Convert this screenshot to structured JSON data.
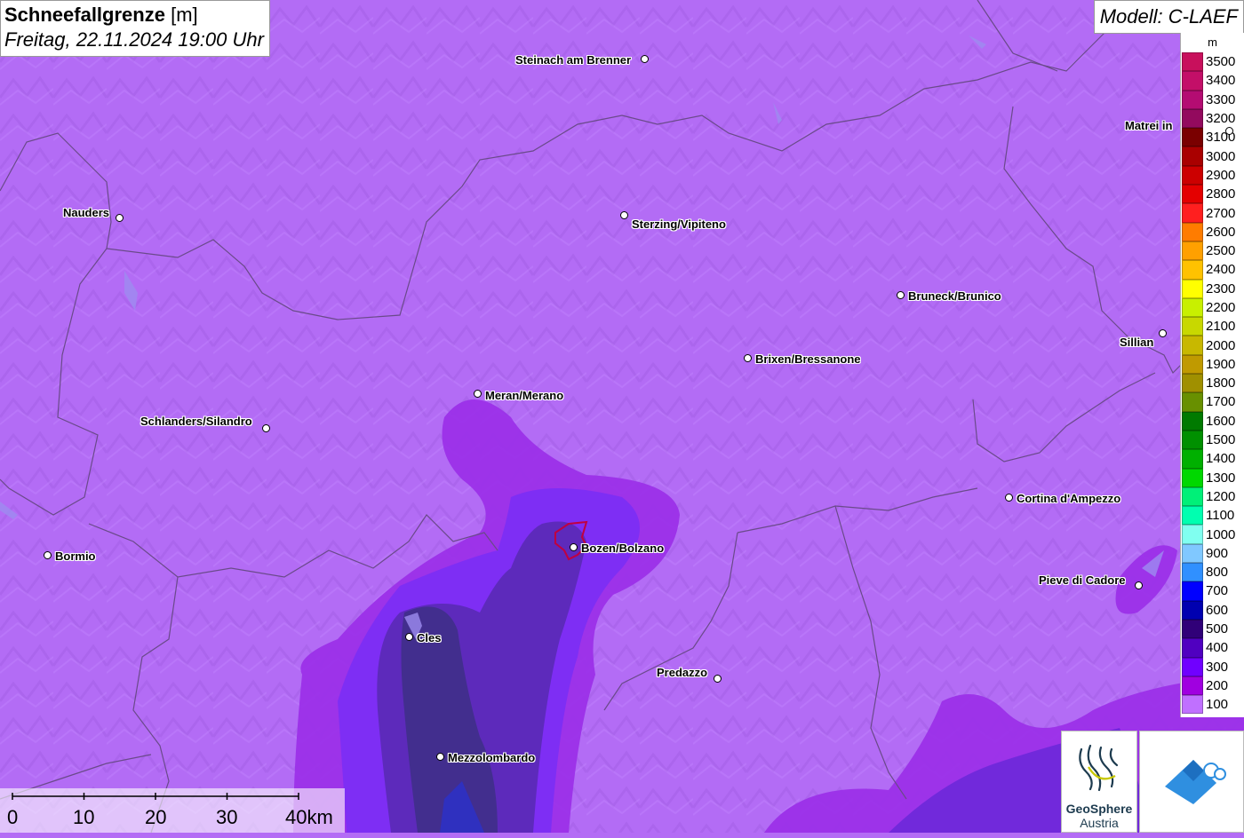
{
  "header": {
    "title_main": "Schneefallgrenze",
    "title_unit": "[m]",
    "datetime": "Freitag, 22.11.2024 19:00 Uhr",
    "model": "Modell: C-LAEF"
  },
  "legend": {
    "unit": "m",
    "items": [
      {
        "label": "3500",
        "color": "#c8105c"
      },
      {
        "label": "3400",
        "color": "#c30f68"
      },
      {
        "label": "3300",
        "color": "#b40c72"
      },
      {
        "label": "3200",
        "color": "#930a5e"
      },
      {
        "label": "3100",
        "color": "#7a0000"
      },
      {
        "label": "3000",
        "color": "#a90000"
      },
      {
        "label": "2900",
        "color": "#cc0000"
      },
      {
        "label": "2800",
        "color": "#e40000"
      },
      {
        "label": "2700",
        "color": "#ff1f1f"
      },
      {
        "label": "2600",
        "color": "#ff7c00"
      },
      {
        "label": "2500",
        "color": "#ffa000"
      },
      {
        "label": "2400",
        "color": "#ffc200"
      },
      {
        "label": "2300",
        "color": "#ffff00"
      },
      {
        "label": "2200",
        "color": "#c8f000"
      },
      {
        "label": "2100",
        "color": "#c8d800"
      },
      {
        "label": "2000",
        "color": "#c8b800"
      },
      {
        "label": "1900",
        "color": "#c09a00"
      },
      {
        "label": "1800",
        "color": "#a09000"
      },
      {
        "label": "1700",
        "color": "#689000"
      },
      {
        "label": "1600",
        "color": "#007a00"
      },
      {
        "label": "1500",
        "color": "#009000"
      },
      {
        "label": "1400",
        "color": "#00b000"
      },
      {
        "label": "1300",
        "color": "#00d800"
      },
      {
        "label": "1200",
        "color": "#00f078"
      },
      {
        "label": "1100",
        "color": "#00ffb0"
      },
      {
        "label": "1000",
        "color": "#80fff0"
      },
      {
        "label": "900",
        "color": "#80c8ff"
      },
      {
        "label": "800",
        "color": "#3090ff"
      },
      {
        "label": "700",
        "color": "#0000ff"
      },
      {
        "label": "600",
        "color": "#0000b0"
      },
      {
        "label": "500",
        "color": "#300078"
      },
      {
        "label": "400",
        "color": "#5000c0"
      },
      {
        "label": "300",
        "color": "#7000ff"
      },
      {
        "label": "200",
        "color": "#a000e0"
      },
      {
        "label": "100",
        "color": "#c070ff"
      }
    ]
  },
  "cities": [
    {
      "name": "Steinach am Brenner"
    },
    {
      "name": "Matrei in"
    },
    {
      "name": "Nauders"
    },
    {
      "name": "Sterzing/Vipiteno"
    },
    {
      "name": "Bruneck/Brunico"
    },
    {
      "name": "Sillian"
    },
    {
      "name": "Brixen/Bressanone"
    },
    {
      "name": "Meran/Merano"
    },
    {
      "name": "Schlanders/Silandro"
    },
    {
      "name": "Cortina d'Ampezzo"
    },
    {
      "name": "Bormio"
    },
    {
      "name": "Bozen/Bolzano"
    },
    {
      "name": "Pieve di Cadore"
    },
    {
      "name": "Cles"
    },
    {
      "name": "Predazzo"
    },
    {
      "name": "Mezzolombardo"
    }
  ],
  "scale": {
    "labels": [
      "0",
      "10",
      "20",
      "30",
      "40km"
    ]
  },
  "logos": {
    "geosphere_line1": "GeoSphere",
    "geosphere_line2": "Austria"
  },
  "colors": {
    "base": "#b36cf5",
    "border": "#6a4a8a"
  }
}
